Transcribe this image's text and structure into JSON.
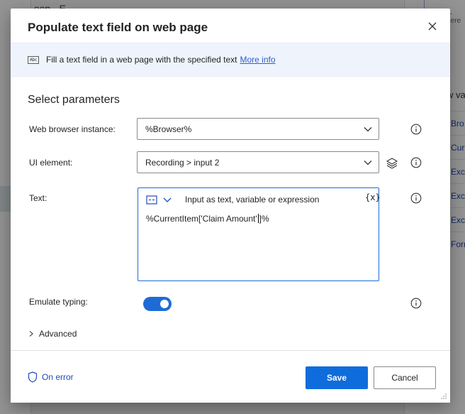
{
  "background": {
    "app_title": "Loop · E___",
    "right_panel_heading": "w va",
    "right_panel_hint": "here",
    "variables": [
      "Bro",
      "Cur",
      "Exce",
      "Exce",
      "Exce",
      "Form"
    ]
  },
  "dialog": {
    "title": "Populate text field on web page",
    "description": "Fill a text field in a web page with the specified text",
    "more_info": "More info",
    "section_title": "Select parameters",
    "info_icon_text": "Abc"
  },
  "fields": {
    "browser_label": "Web browser instance:",
    "browser_value": "%Browser%",
    "ui_element_label": "UI element:",
    "ui_element_value": "Recording > input 2",
    "text_label": "Text:",
    "text_mode_hint": "Input as text, variable or expression",
    "text_fx": "{x}",
    "text_value_before_caret": "%CurrentItem['Claim Amount'",
    "text_value_after_caret": "]%",
    "emulate_label": "Emulate typing:",
    "emulate_on": true,
    "advanced_label": "Advanced"
  },
  "footer": {
    "on_error": "On error",
    "save": "Save",
    "cancel": "Cancel"
  },
  "colors": {
    "accent": "#0f6cdc",
    "link": "#2c5ec9",
    "info_bar": "#eff4fc"
  }
}
